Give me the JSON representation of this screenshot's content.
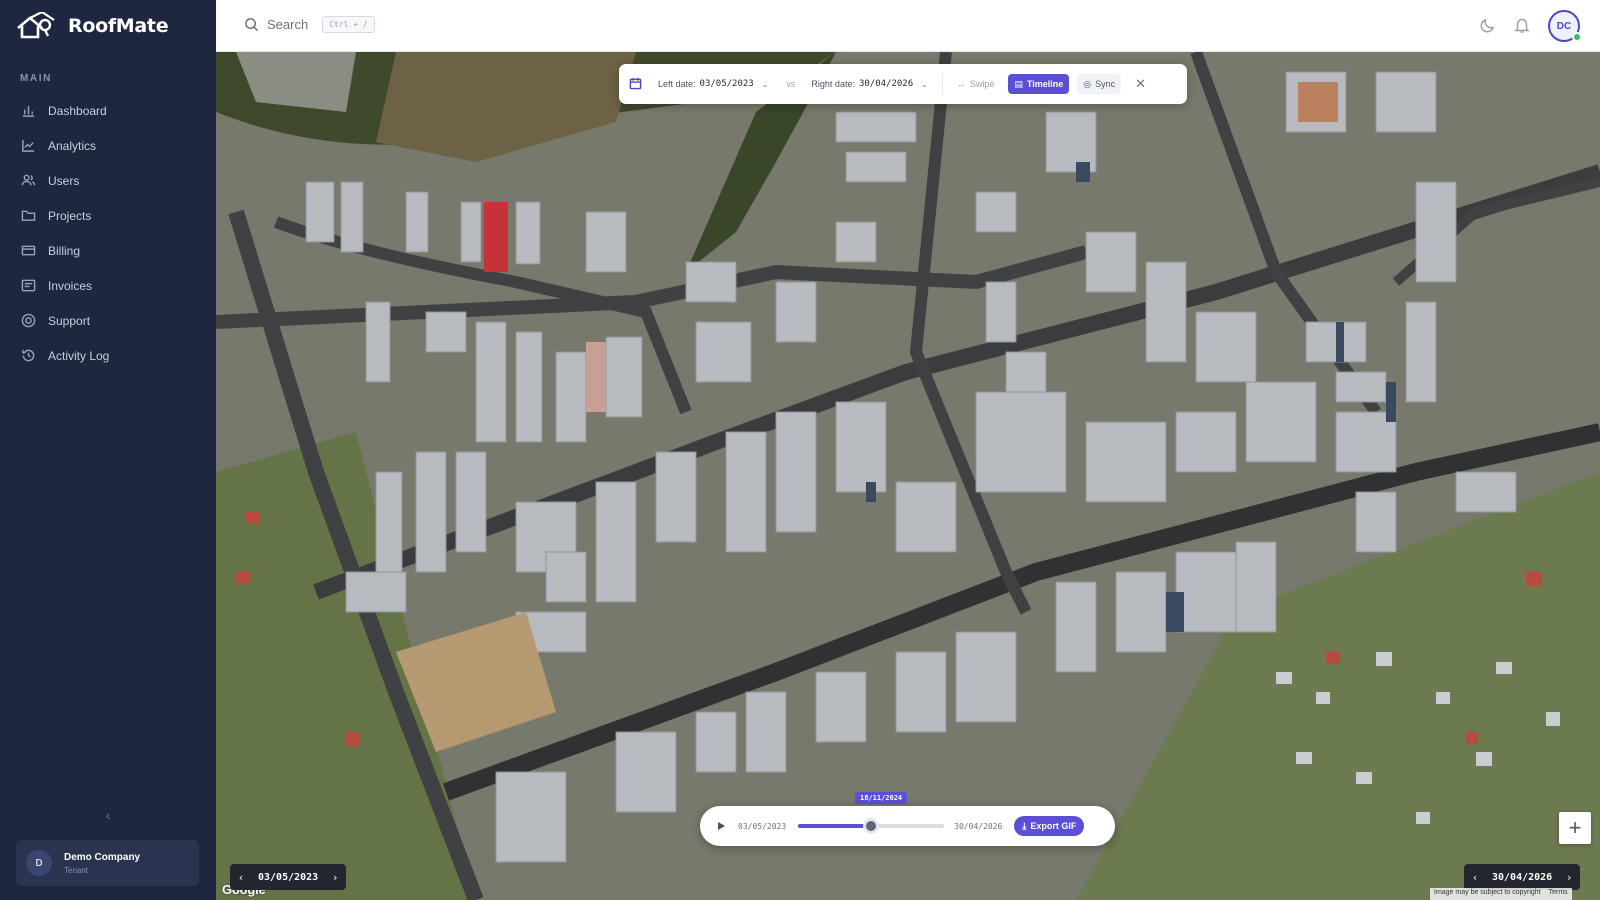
{
  "app": {
    "name": "RoofMate"
  },
  "sidebar": {
    "section_label": "MAIN",
    "items": [
      {
        "label": "Dashboard",
        "icon": "bar-chart-icon"
      },
      {
        "label": "Analytics",
        "icon": "trend-chart-icon"
      },
      {
        "label": "Users",
        "icon": "users-icon"
      },
      {
        "label": "Projects",
        "icon": "folder-icon"
      },
      {
        "label": "Billing",
        "icon": "card-icon"
      },
      {
        "label": "Invoices",
        "icon": "invoice-icon"
      },
      {
        "label": "Support",
        "icon": "lifebuoy-icon"
      },
      {
        "label": "Activity Log",
        "icon": "history-icon"
      }
    ],
    "collapse_symbol": "‹",
    "company": {
      "initial": "D",
      "name": "Demo Company",
      "role": "Tenant"
    }
  },
  "header": {
    "search_label": "Search",
    "search_shortcut": "Ctrl + /",
    "user_initials": "DC"
  },
  "compare": {
    "left_label": "Left date:",
    "left_value": "03/05/2023",
    "vs": "vs",
    "right_label": "Right date:",
    "right_value": "30/04/2026",
    "modes": {
      "swipe": "Swipe",
      "timeline": "Timeline",
      "sync": "Sync"
    },
    "active_mode": "Timeline"
  },
  "timeline": {
    "start": "03/05/2023",
    "end": "30/04/2026",
    "current": "18/11/2024",
    "progress": 0.5,
    "export_label": "Export GIF"
  },
  "map": {
    "left_pill_date": "03/05/2023",
    "right_pill_date": "30/04/2026",
    "zoom_in": "+",
    "attribution": "Image may be subject to copyright",
    "terms": "Terms",
    "provider": "Google"
  },
  "colors": {
    "sidebar_bg": "#1e2640",
    "accent": "#5b4fd6",
    "online": "#22c55e"
  }
}
